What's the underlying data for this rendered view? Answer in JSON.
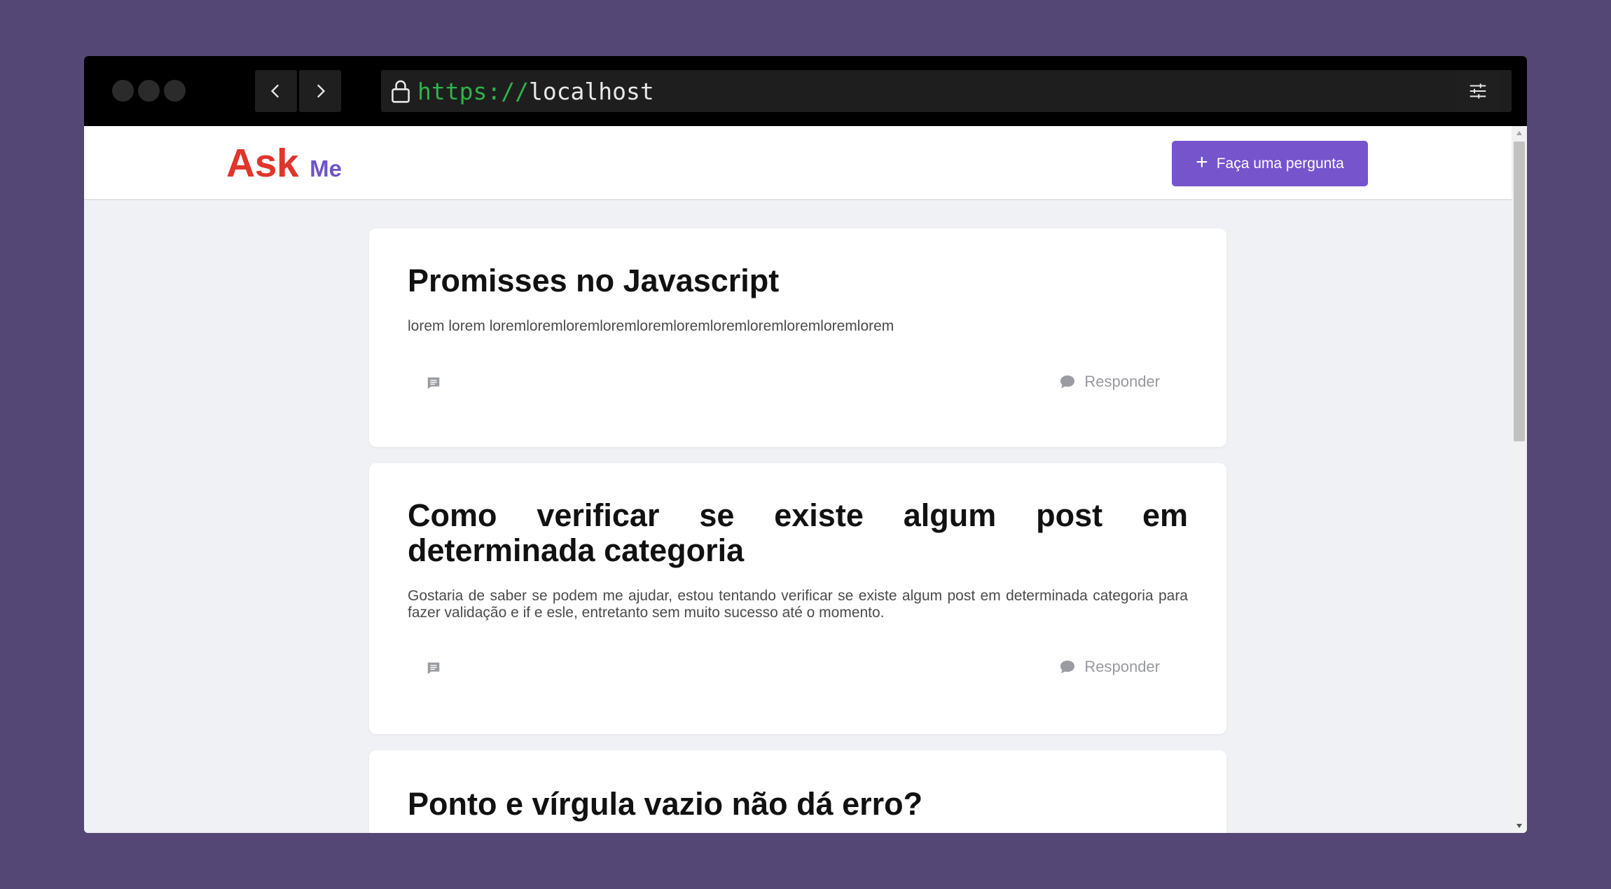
{
  "browser": {
    "url_scheme": "https://",
    "url_host": "localhost"
  },
  "header": {
    "logo_main": "Ask",
    "logo_sub": "Me",
    "ask_button_icon": "+",
    "ask_button_label": "Faça uma pergunta"
  },
  "questions": [
    {
      "title": "Promisses no Javascript",
      "body": "lorem lorem loremloremloremloremloremloremloremloremloremloremlorem",
      "reply_label": "Responder"
    },
    {
      "title": "Como verificar se existe algum post em determinada categoria",
      "body": "Gostaria de saber se podem me ajudar, estou tentando verificar se existe algum post em determinada categoria para fazer validação e if e esle, entretanto sem muito sucesso até o momento.",
      "reply_label": "Responder"
    },
    {
      "title": "Ponto e vírgula vazio não dá erro?"
    }
  ],
  "colors": {
    "page_background": "#544776",
    "logo_ask": "#e0352b",
    "logo_me": "#6f54c8",
    "primary_button": "#7554cc",
    "url_scheme": "#2fb34a"
  }
}
